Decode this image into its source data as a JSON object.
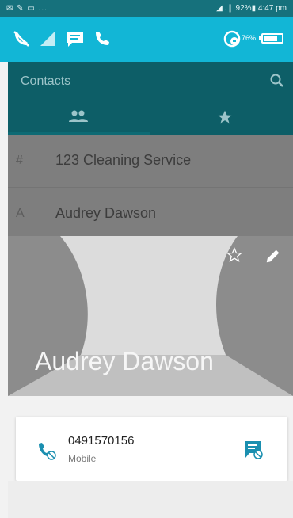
{
  "status_bar": {
    "left": "✉ ✎ ▭ ...",
    "right": "◢ .❙ 92%▮ 4:47 pm"
  },
  "notifications": {
    "battery_text": "76%",
    "battery_level": 0.76,
    "accent": "#12b6d6"
  },
  "app_bar": {
    "title": "Contacts",
    "tabs": [
      "people-icon",
      "star-icon"
    ],
    "color": "#0d5e67"
  },
  "contacts": [
    {
      "section": "#",
      "name": "123 Cleaning Service"
    },
    {
      "section": "A",
      "name": "Audrey Dawson"
    }
  ],
  "detail": {
    "name": "Audrey Dawson",
    "phone_number": "0491570156",
    "phone_type": "Mobile",
    "action_color": "#1a8fb0"
  }
}
